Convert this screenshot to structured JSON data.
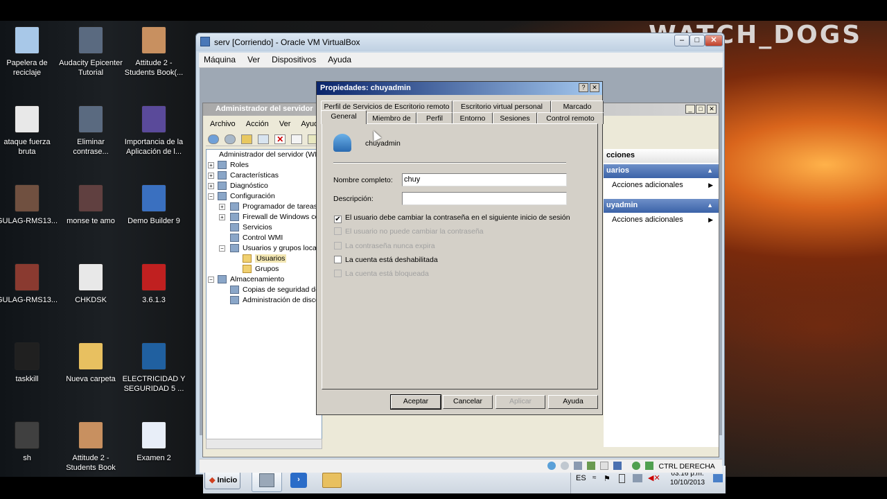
{
  "brand": "WATCH_DOGS",
  "desktop_icons": [
    {
      "label": "Papelera de reciclaje",
      "icon": "recycle-bin-icon",
      "color": "#a8c8e8"
    },
    {
      "label": "Audacity Epicenter Tutorial",
      "icon": "video-file-icon",
      "color": "#5a6a80"
    },
    {
      "label": "Attitude 2 - Students Book(...",
      "icon": "pdf-file-icon",
      "color": "#c89060"
    },
    {
      "label": "ataque fuerza bruta",
      "icon": "word-doc-icon",
      "color": "#e8e8e8"
    },
    {
      "label": "Eliminar contrase...",
      "icon": "video-file-icon",
      "color": "#5a6a80"
    },
    {
      "label": "Importancia de la Aplicación de l...",
      "icon": "powerpoint-icon",
      "color": "#5a4a9a"
    },
    {
      "label": "GULAG-RMS13...",
      "icon": "video-file-icon",
      "color": "#705040"
    },
    {
      "label": "monse te amo",
      "icon": "image-file-icon",
      "color": "#604040"
    },
    {
      "label": "Demo Builder 9",
      "icon": "clapper-icon",
      "color": "#3a70c0"
    },
    {
      "label": "GULAG-RMS13...",
      "icon": "video-file-icon",
      "color": "#8a3a30"
    },
    {
      "label": "CHKDSK",
      "icon": "word-doc-icon",
      "color": "#e8e8e8"
    },
    {
      "label": "3.6.1.3",
      "icon": "acrobat-icon",
      "color": "#c02020"
    },
    {
      "label": "taskkill",
      "icon": "cmd-icon",
      "color": "#202020"
    },
    {
      "label": "Nueva carpeta",
      "icon": "folder-icon",
      "color": "#e8c060"
    },
    {
      "label": "ELECTRICIDAD Y SEGURIDAD 5 ...",
      "icon": "video-file-icon",
      "color": "#2060a0"
    },
    {
      "label": "sh",
      "icon": "cmd-icon",
      "color": "#404040"
    },
    {
      "label": "Attitude 2 - Students Book",
      "icon": "pdf-file-icon",
      "color": "#c89060"
    },
    {
      "label": "Examen 2",
      "icon": "word-doc-icon",
      "color": "#e8eef8"
    }
  ],
  "vbox": {
    "title": "serv [Corriendo] - Oracle VM VirtualBox",
    "menu": [
      "Máquina",
      "Ver",
      "Dispositivos",
      "Ayuda"
    ],
    "status_text": "CTRL DERECHA"
  },
  "server_manager": {
    "title": "Administrador del servidor",
    "menu": [
      "Archivo",
      "Acción",
      "Ver",
      "Ayuda"
    ],
    "tree": [
      {
        "label": "Administrador del servidor (WIN",
        "exp": "",
        "level": 0
      },
      {
        "label": "Roles",
        "exp": "+",
        "level": 1
      },
      {
        "label": "Características",
        "exp": "+",
        "level": 1
      },
      {
        "label": "Diagnóstico",
        "exp": "+",
        "level": 1
      },
      {
        "label": "Configuración",
        "exp": "−",
        "level": 1
      },
      {
        "label": "Programador de tareas",
        "exp": "+",
        "level": 2
      },
      {
        "label": "Firewall de Windows con",
        "exp": "+",
        "level": 2
      },
      {
        "label": "Servicios",
        "exp": "",
        "level": 2
      },
      {
        "label": "Control WMI",
        "exp": "",
        "level": 2
      },
      {
        "label": "Usuarios y grupos locale",
        "exp": "−",
        "level": 2
      },
      {
        "label": "Usuarios",
        "exp": "",
        "level": 3,
        "selected": true
      },
      {
        "label": "Grupos",
        "exp": "",
        "level": 3
      },
      {
        "label": "Almacenamiento",
        "exp": "−",
        "level": 1
      },
      {
        "label": "Copias de seguridad de",
        "exp": "",
        "level": 2
      },
      {
        "label": "Administración de discos",
        "exp": "",
        "level": 2
      }
    ],
    "actions_header": "cciones",
    "action_sections": [
      {
        "title": "uarios",
        "item": "Acciones adicionales"
      },
      {
        "title": "uyadmin",
        "item": "Acciones adicionales"
      }
    ]
  },
  "dialog": {
    "title": "Propiedades: chuyadmin",
    "help": "?",
    "close": "✕",
    "tabs_back": [
      "Perfil de Servicios de Escritorio remoto",
      "Escritorio virtual personal",
      "Marcado"
    ],
    "tabs_front": [
      "General",
      "Miembro de",
      "Perfil",
      "Entorno",
      "Sesiones",
      "Control remoto"
    ],
    "username": "chuyadmin",
    "full_name_label": "Nombre completo:",
    "full_name_value": "chuy",
    "description_label": "Descripción:",
    "description_value": "",
    "checkboxes": [
      {
        "label": "El usuario debe cambiar la contraseña en el siguiente inicio de sesión",
        "checked": true,
        "disabled": false
      },
      {
        "label": "El usuario no puede cambiar la contraseña",
        "checked": false,
        "disabled": true
      },
      {
        "label": "La contraseña nunca expira",
        "checked": false,
        "disabled": true
      },
      {
        "label": "La cuenta está deshabilitada",
        "checked": false,
        "disabled": false
      },
      {
        "label": "La cuenta está bloqueada",
        "checked": false,
        "disabled": true
      }
    ],
    "buttons": {
      "ok": "Aceptar",
      "cancel": "Cancelar",
      "apply": "Aplicar",
      "help": "Ayuda"
    }
  },
  "guest_taskbar": {
    "start": "Inicio",
    "lang": "ES",
    "time": "03:16 p.m.",
    "date": "10/10/2013"
  }
}
